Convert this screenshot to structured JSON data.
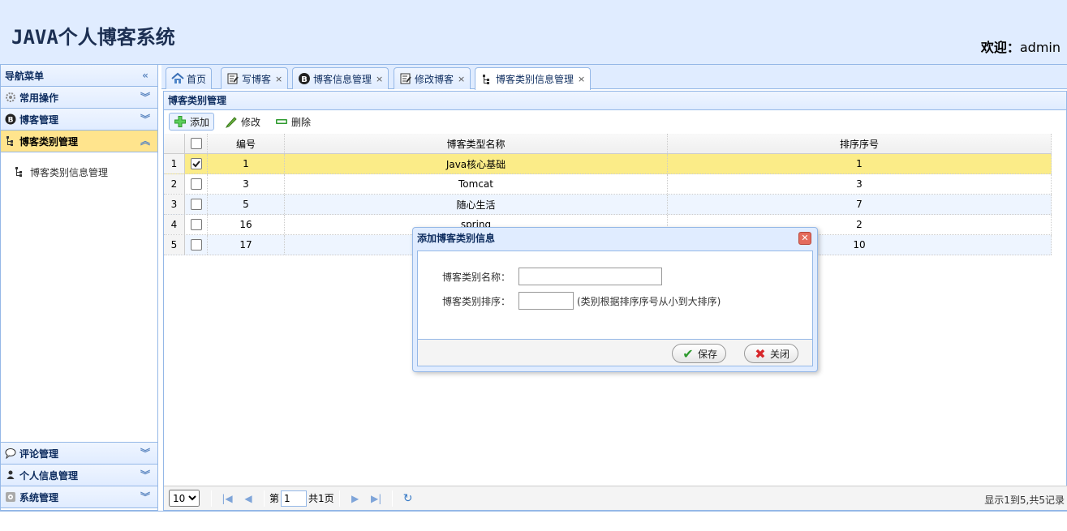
{
  "header": {
    "app_title": "JAVA个人博客系统",
    "welcome_label": "欢迎：",
    "username": "admin"
  },
  "sidebar": {
    "title": "导航菜单",
    "sections": [
      {
        "label": "常用操作",
        "icon": "gear-icon"
      },
      {
        "label": "博客管理",
        "icon": "blog-icon"
      },
      {
        "label": "博客类别管理",
        "icon": "tree-icon"
      }
    ],
    "active_items": [
      {
        "label": "博客类别信息管理",
        "icon": "tree-icon"
      }
    ],
    "bottom_sections": [
      {
        "label": "评论管理",
        "icon": "comment-icon"
      },
      {
        "label": "个人信息管理",
        "icon": "user-icon"
      },
      {
        "label": "系统管理",
        "icon": "system-icon"
      }
    ]
  },
  "tabs": [
    {
      "label": "首页",
      "icon": "home-icon",
      "closable": false
    },
    {
      "label": "写博客",
      "icon": "edit-icon",
      "closable": true
    },
    {
      "label": "博客信息管理",
      "icon": "blog-icon",
      "closable": true
    },
    {
      "label": "修改博客",
      "icon": "edit-icon",
      "closable": true
    },
    {
      "label": "博客类别信息管理",
      "icon": "tree-icon",
      "closable": true
    }
  ],
  "panel": {
    "title": "博客类别管理",
    "toolbar": {
      "add_label": "添加",
      "edit_label": "修改",
      "delete_label": "删除"
    }
  },
  "grid": {
    "columns": [
      "编号",
      "博客类型名称",
      "排序序号"
    ],
    "rows": [
      {
        "num": "1",
        "id": "1",
        "name": "Java核心基础",
        "order": "1",
        "checked": true
      },
      {
        "num": "2",
        "id": "3",
        "name": "Tomcat",
        "order": "3",
        "checked": false
      },
      {
        "num": "3",
        "id": "5",
        "name": "随心生活",
        "order": "7",
        "checked": false
      },
      {
        "num": "4",
        "id": "16",
        "name": "spring",
        "order": "2",
        "checked": false
      },
      {
        "num": "5",
        "id": "17",
        "name": "",
        "order": "10",
        "checked": false
      }
    ]
  },
  "pager": {
    "page_size": "10",
    "page_prefix": "第",
    "page_value": "1",
    "page_total": "共1页",
    "info": "显示1到5,共5记录"
  },
  "dialog": {
    "title": "添加博客类别信息",
    "name_label": "博客类别名称：",
    "order_label": "博客类别排序：",
    "order_hint": "(类别根据排序序号从小到大排序)",
    "name_value": "",
    "order_value": "",
    "save_label": "保存",
    "close_label": "关闭"
  },
  "colors": {
    "header_bg": "#e0ecff",
    "border": "#95b8e7",
    "selected_row": "#fbec88",
    "active_section": "#ffe48d"
  }
}
